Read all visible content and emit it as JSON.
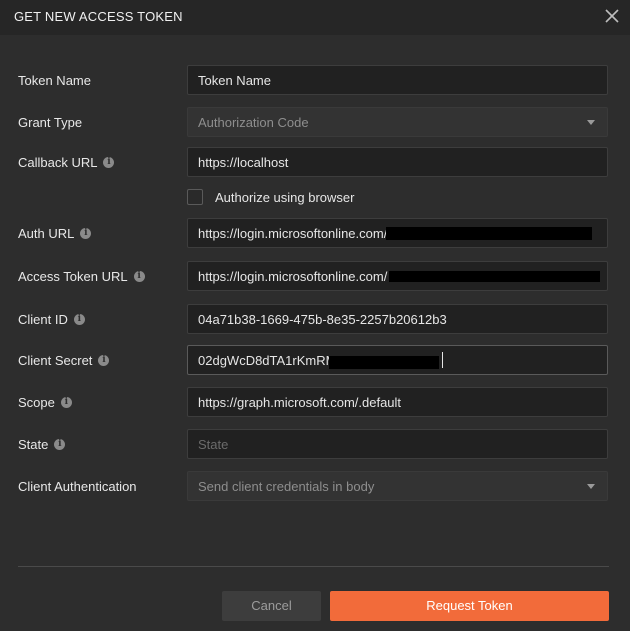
{
  "dialog": {
    "title": "GET NEW ACCESS TOKEN"
  },
  "form": {
    "token_name": {
      "label": "Token Name",
      "value": "Token Name"
    },
    "grant_type": {
      "label": "Grant Type",
      "value": "Authorization Code"
    },
    "callback_url": {
      "label": "Callback URL",
      "value": "https://localhost"
    },
    "authorize_browser": {
      "label": "Authorize using browser",
      "checked": false
    },
    "auth_url": {
      "label": "Auth URL",
      "value": "https://login.microsoftonline.com/"
    },
    "access_token_url": {
      "label": "Access Token URL",
      "value": "https://login.microsoftonline.com/"
    },
    "client_id": {
      "label": "Client ID",
      "value": "04a71b38-1669-475b-8e35-2257b20612b3"
    },
    "client_secret": {
      "label": "Client Secret",
      "value": "02dgWcD8dTA1rKmRM"
    },
    "scope": {
      "label": "Scope",
      "value": "https://graph.microsoft.com/.default"
    },
    "state": {
      "label": "State",
      "placeholder": "State",
      "value": ""
    },
    "client_auth": {
      "label": "Client Authentication",
      "value": "Send client credentials in body"
    }
  },
  "buttons": {
    "cancel": "Cancel",
    "request_token": "Request Token"
  },
  "colors": {
    "accent": "#f26b3a",
    "background": "#2d2d2d",
    "input_background": "#212121"
  },
  "icons": {
    "close": "close-icon",
    "info": "info-icon",
    "dropdown": "chevron-down-icon"
  }
}
